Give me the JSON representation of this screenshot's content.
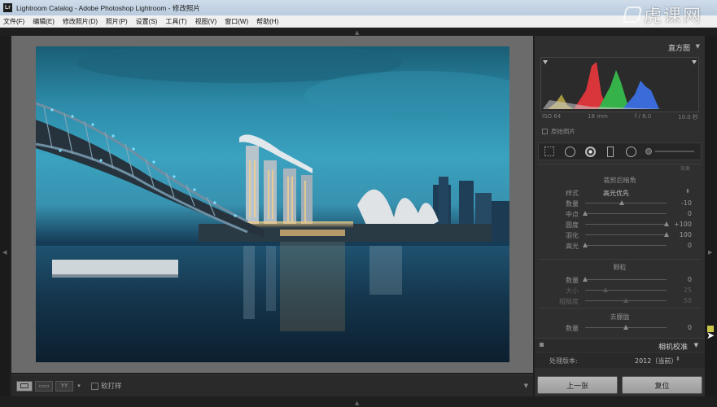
{
  "window": {
    "icon_label": "Lr",
    "title": "Lightroom Catalog - Adobe Photoshop Lightroom - 修改照片"
  },
  "menu": [
    "文件(F)",
    "编辑(E)",
    "修改照片(D)",
    "照片(P)",
    "设置(S)",
    "工具(T)",
    "视图(V)",
    "窗口(W)",
    "帮助(H)"
  ],
  "watermark": {
    "text": "虎课网"
  },
  "toolbar": {
    "soft_proof_label": "软打样"
  },
  "panel": {
    "title": "直方图",
    "histogram_info": {
      "iso": "ISO 64",
      "focal": "18 mm",
      "aperture": "f / 8.0",
      "shutter": "10.0 秒"
    },
    "original_photo_label": "原始照片",
    "collapsed_section": "效果",
    "vignette": {
      "title": "裁剪后暗角",
      "style_label": "样式",
      "style_value": "高光优先",
      "rows": [
        {
          "label": "数量",
          "value": "-10",
          "position": 0.45,
          "dim": false
        },
        {
          "label": "中点",
          "value": "0",
          "position": 0.0,
          "dim": false
        },
        {
          "label": "圆度",
          "value": "+100",
          "position": 1.0,
          "dim": false
        },
        {
          "label": "羽化",
          "value": "100",
          "position": 1.0,
          "dim": false
        },
        {
          "label": "高光",
          "value": "0",
          "position": 0.0,
          "dim": false
        }
      ]
    },
    "grain": {
      "title": "颗粒",
      "rows": [
        {
          "label": "数量",
          "value": "0",
          "position": 0.0,
          "dim": false
        },
        {
          "label": "大小",
          "value": "25",
          "position": 0.25,
          "dim": true
        },
        {
          "label": "粗糙度",
          "value": "50",
          "position": 0.5,
          "dim": true
        }
      ]
    },
    "dehaze": {
      "title": "去朦胧",
      "rows": [
        {
          "label": "数量",
          "value": "0",
          "position": 0.5,
          "dim": false
        }
      ]
    },
    "camera_calibration": {
      "title": "相机校准",
      "process_label": "处理版本:",
      "process_value": "2012（当前）"
    },
    "buttons": {
      "previous": "上一张",
      "reset": "复位"
    }
  }
}
